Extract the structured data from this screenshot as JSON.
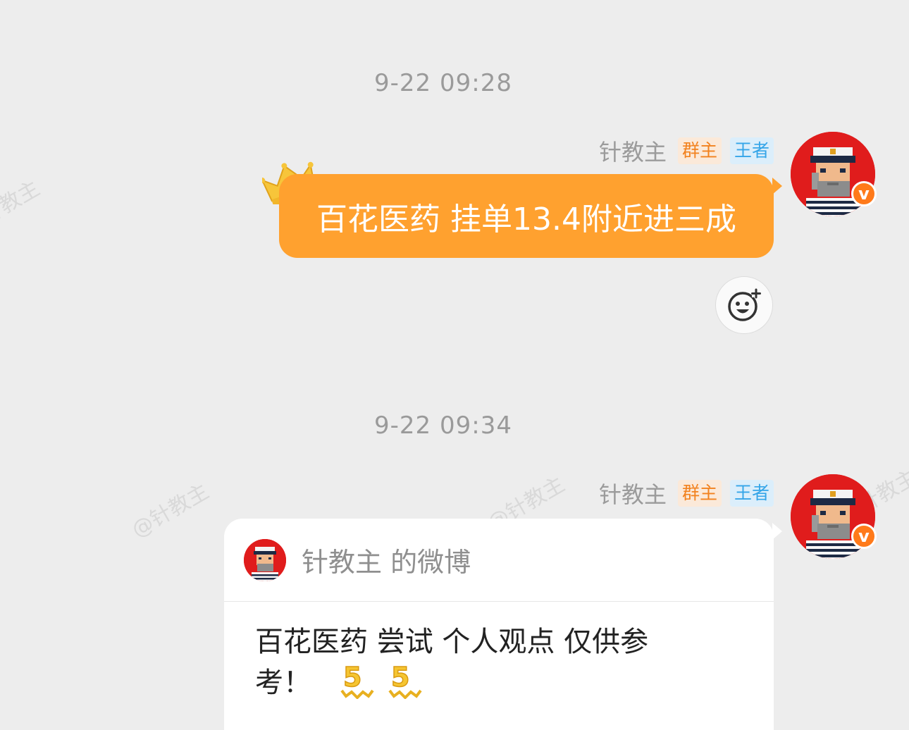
{
  "watermark_text": "@针教主",
  "messages": [
    {
      "timestamp": "9-22 09:28",
      "sender": "针教主",
      "badge_owner": "群主",
      "badge_rank": "王者",
      "text": "百花医药 挂单13.4附近进三成"
    },
    {
      "timestamp": "9-22 09:34",
      "sender": "针教主",
      "badge_owner": "群主",
      "badge_rank": "王者",
      "card": {
        "title": "针教主 的微博",
        "body_line1": "百花医药 尝试 个人观点 仅供参",
        "body_line2": "考！"
      }
    }
  ],
  "colors": {
    "bubble": "#ffa12f",
    "avatar_bg": "#e01c1c",
    "verified_badge": "#ff7a1a"
  },
  "icons": {
    "crown": "crown-icon",
    "emoji_reaction": "add-emoji-icon",
    "verified": "verified-v-icon"
  }
}
